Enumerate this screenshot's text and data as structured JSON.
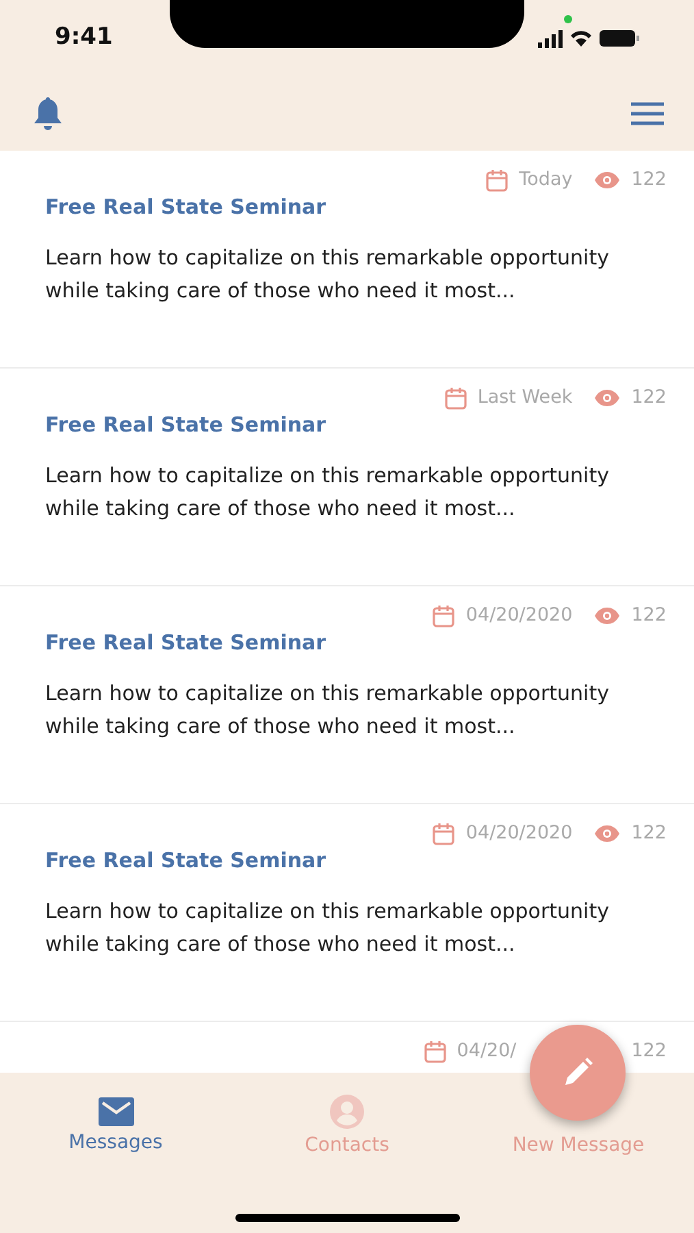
{
  "status_bar": {
    "time": "9:41"
  },
  "messages": [
    {
      "kind": "full",
      "date": "Today",
      "views": "122",
      "title": "Free Real State Seminar",
      "body": "Learn how to capitalize on this remarkable opportunity while taking care of those who need it most..."
    },
    {
      "kind": "full",
      "date": "Last Week",
      "views": "122",
      "title": "Free Real State Seminar",
      "body": "Learn how to capitalize on this remarkable opportunity while taking care of those who need it most..."
    },
    {
      "kind": "full",
      "date": "04/20/2020",
      "views": "122",
      "title": "Free Real State Seminar",
      "body": "Learn how to capitalize on this remarkable opportunity while taking care of those who need it most..."
    },
    {
      "kind": "full",
      "date": "04/20/2020",
      "views": "122",
      "title": "Free Real State Seminar",
      "body": "Learn how to capitalize on this remarkable opportunity while taking care of those who need it most..."
    },
    {
      "kind": "partial",
      "date": "04/20/",
      "views": "122"
    }
  ],
  "tabs": [
    {
      "label": "Messages",
      "selected": true
    },
    {
      "label": "Contacts",
      "selected": false
    },
    {
      "label": "New Message",
      "selected": false
    }
  ]
}
